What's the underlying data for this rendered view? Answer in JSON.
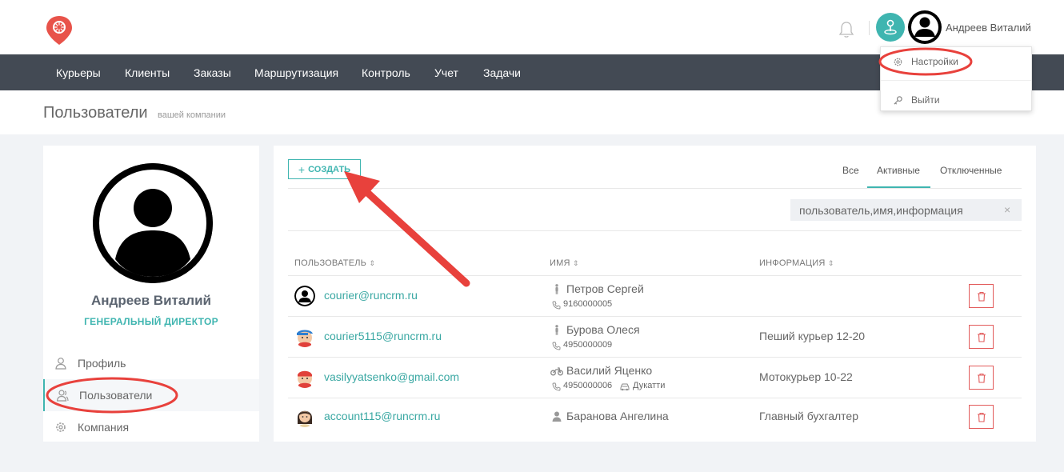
{
  "header": {
    "user_name": "Андреев Виталий"
  },
  "nav": {
    "items": [
      {
        "label": "Курьеры"
      },
      {
        "label": "Клиенты"
      },
      {
        "label": "Заказы"
      },
      {
        "label": "Маршрутизация"
      },
      {
        "label": "Контроль"
      },
      {
        "label": "Учет"
      },
      {
        "label": "Задачи"
      }
    ]
  },
  "dropdown": {
    "settings_label": "Настройки",
    "logout_label": "Выйти"
  },
  "page": {
    "title": "Пользователи",
    "subtitle": "вашей компании"
  },
  "profile": {
    "name": "Андреев Виталий",
    "role": "ГЕНЕРАЛЬНЫЙ ДИРЕКТОР",
    "menu": [
      {
        "label": "Профиль",
        "icon": "user-icon"
      },
      {
        "label": "Пользователи",
        "icon": "users-icon"
      },
      {
        "label": "Компания",
        "icon": "gear-icon"
      }
    ]
  },
  "toolbar": {
    "create_label": "СОЗДАТЬ",
    "tabs": [
      {
        "label": "Все"
      },
      {
        "label": "Активные",
        "active": true
      },
      {
        "label": "Отключенные"
      }
    ],
    "search_placeholder": "пользователь,имя,информация",
    "clear": "×"
  },
  "table": {
    "columns": [
      {
        "label": "ПОЛЬЗОВАТЕЛЬ"
      },
      {
        "label": "ИМЯ"
      },
      {
        "label": "ИНФОРМАЦИЯ"
      }
    ],
    "sort_glyph": "⇕",
    "rows": [
      {
        "email": "courier@runcrm.ru",
        "name": "Петров Сергей",
        "phone": "9160000005",
        "vehicle": "",
        "info": "",
        "avatar": "default-avatar",
        "type": "walker-icon"
      },
      {
        "email": "courier5115@runcrm.ru",
        "name": "Бурова Олеся",
        "phone": "4950000009",
        "vehicle": "",
        "info": "Пеший курьер 12-20",
        "avatar": "courier-avatar",
        "type": "walker-icon"
      },
      {
        "email": "vasilyyatsenko@gmail.com",
        "name": "Василий Яценко",
        "phone": "4950000006",
        "vehicle": "Дукатти",
        "info": "Мотокурьер 10-22",
        "avatar": "courier-avatar",
        "type": "motorcycle-icon"
      },
      {
        "email": "account115@runcrm.ru",
        "name": "Баранова Ангелина",
        "phone": "",
        "vehicle": "",
        "info": "Главный бухгалтер",
        "avatar": "woman-avatar",
        "type": "person-icon"
      }
    ]
  },
  "colors": {
    "accent": "#3fb5b0",
    "navbar": "#434a54",
    "delete": "#e25b5b",
    "annotation": "#e8413c"
  }
}
